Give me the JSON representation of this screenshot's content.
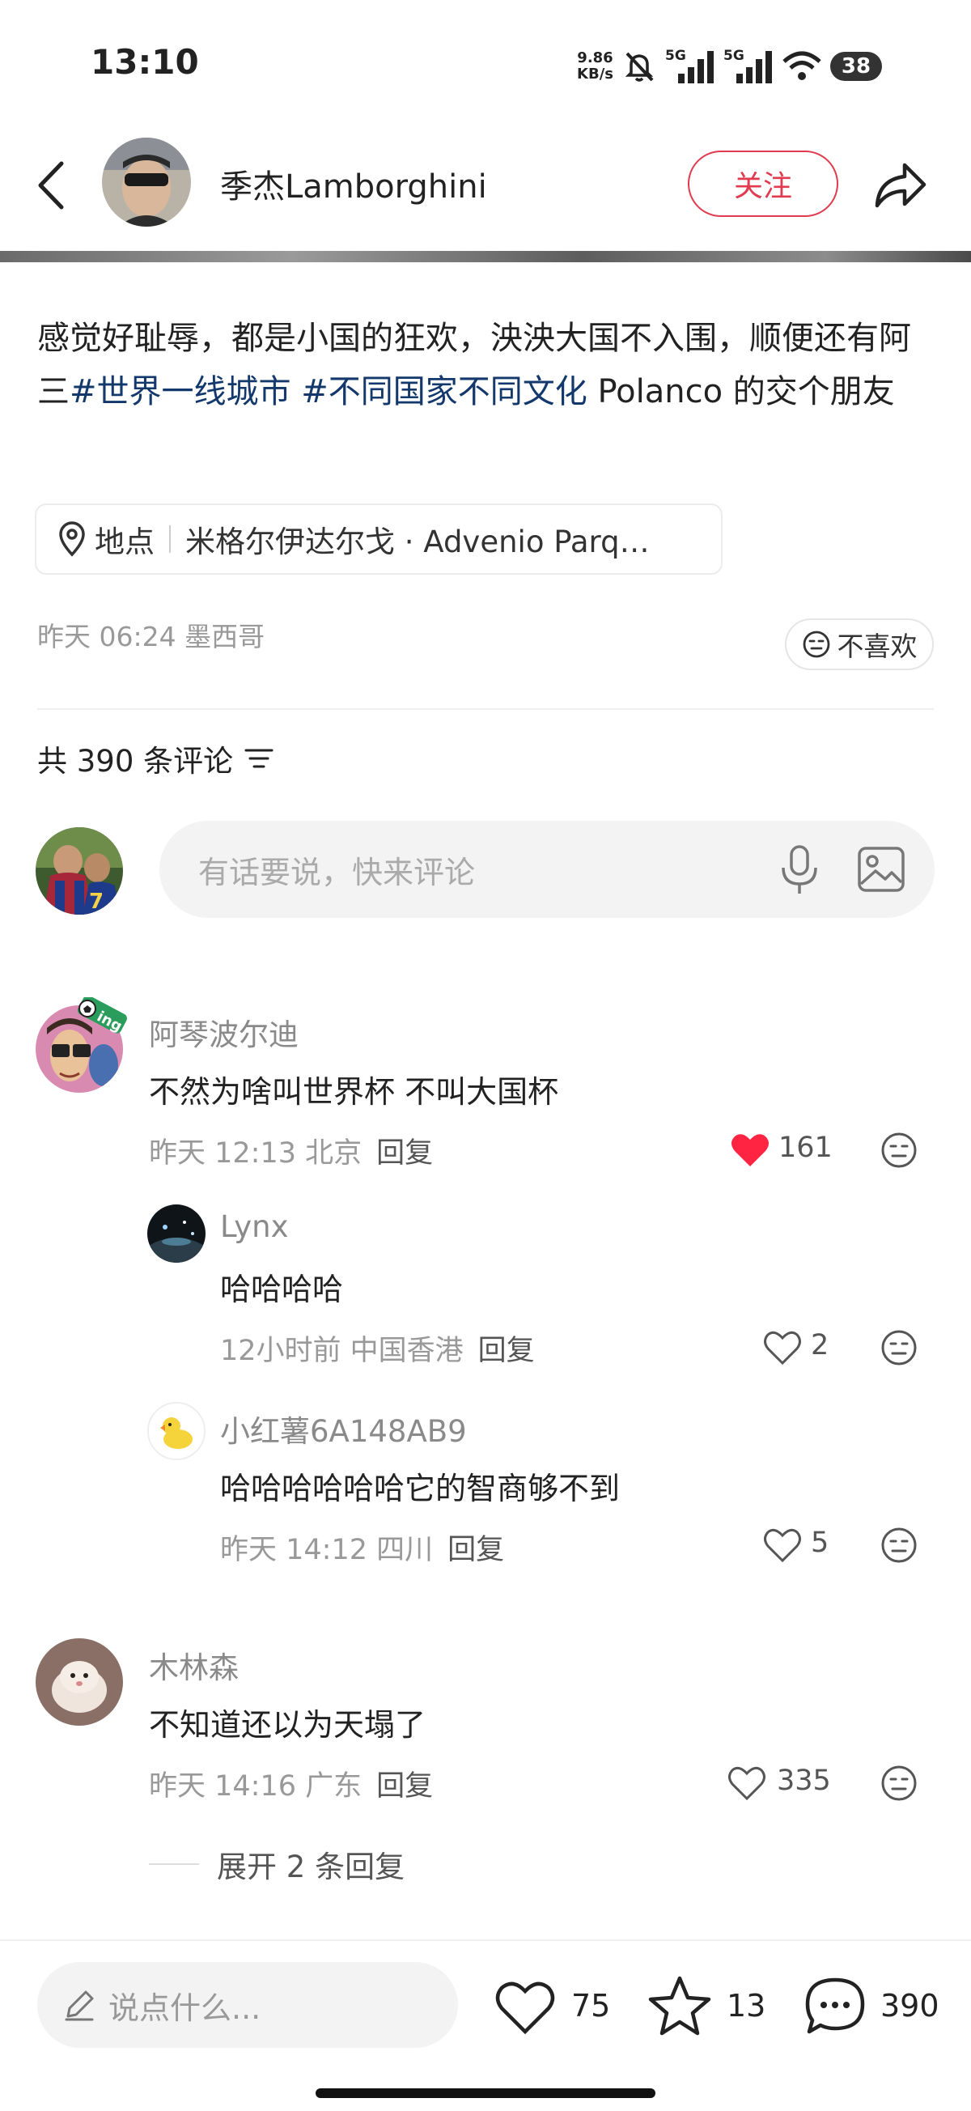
{
  "status_bar": {
    "time": "13:10",
    "net_speed_value": "9.86",
    "net_speed_unit": "KB/s",
    "signal_1_label": "5G",
    "signal_2_label": "5G",
    "battery": "38"
  },
  "header": {
    "author_name": "季杰Lamborghini",
    "follow_label": "关注"
  },
  "post": {
    "text_part1": "感觉好耻辱，都是小国的狂欢，泱泱大国不入围，顺便还有阿三",
    "hashtag1": "#世界一线城市",
    "hashtag2": "#不同国家不同文化",
    "text_part2": " Polanco 的交个朋友",
    "location_label": "地点",
    "location_value": "米格尔伊达尔戈 · Advenio Parq…",
    "meta": "昨天 06:24 墨西哥",
    "dislike_label": "不喜欢"
  },
  "comments_header": {
    "count_label": "共 390 条评论",
    "input_placeholder": "有话要说，快来评论"
  },
  "comments": [
    {
      "name": "阿琴波尔迪",
      "text": "不然为啥叫世界杯 不叫大国杯",
      "meta": "昨天 12:13 北京",
      "reply_label": "回复",
      "likes": "161",
      "avatar_badge": "ing",
      "replies": [
        {
          "name": "Lynx",
          "text": "哈哈哈哈",
          "meta": "12小时前 中国香港",
          "reply_label": "回复",
          "likes": "2"
        },
        {
          "name": "小红薯6A148AB9",
          "text": "哈哈哈哈哈哈它的智商够不到",
          "meta": "昨天 14:12 四川",
          "reply_label": "回复",
          "likes": "5"
        }
      ]
    },
    {
      "name": "木林森",
      "text": "不知道还以为天塌了",
      "meta": "昨天 14:16 广东",
      "reply_label": "回复",
      "likes": "335",
      "expand_label": "展开 2 条回复"
    }
  ],
  "bottom_bar": {
    "input_placeholder": "说点什么...",
    "likes": "75",
    "favorites": "13",
    "comments": "390"
  },
  "colors": {
    "accent": "#e23a4e",
    "hashtag": "#13386c",
    "liked": "#ff2442"
  }
}
